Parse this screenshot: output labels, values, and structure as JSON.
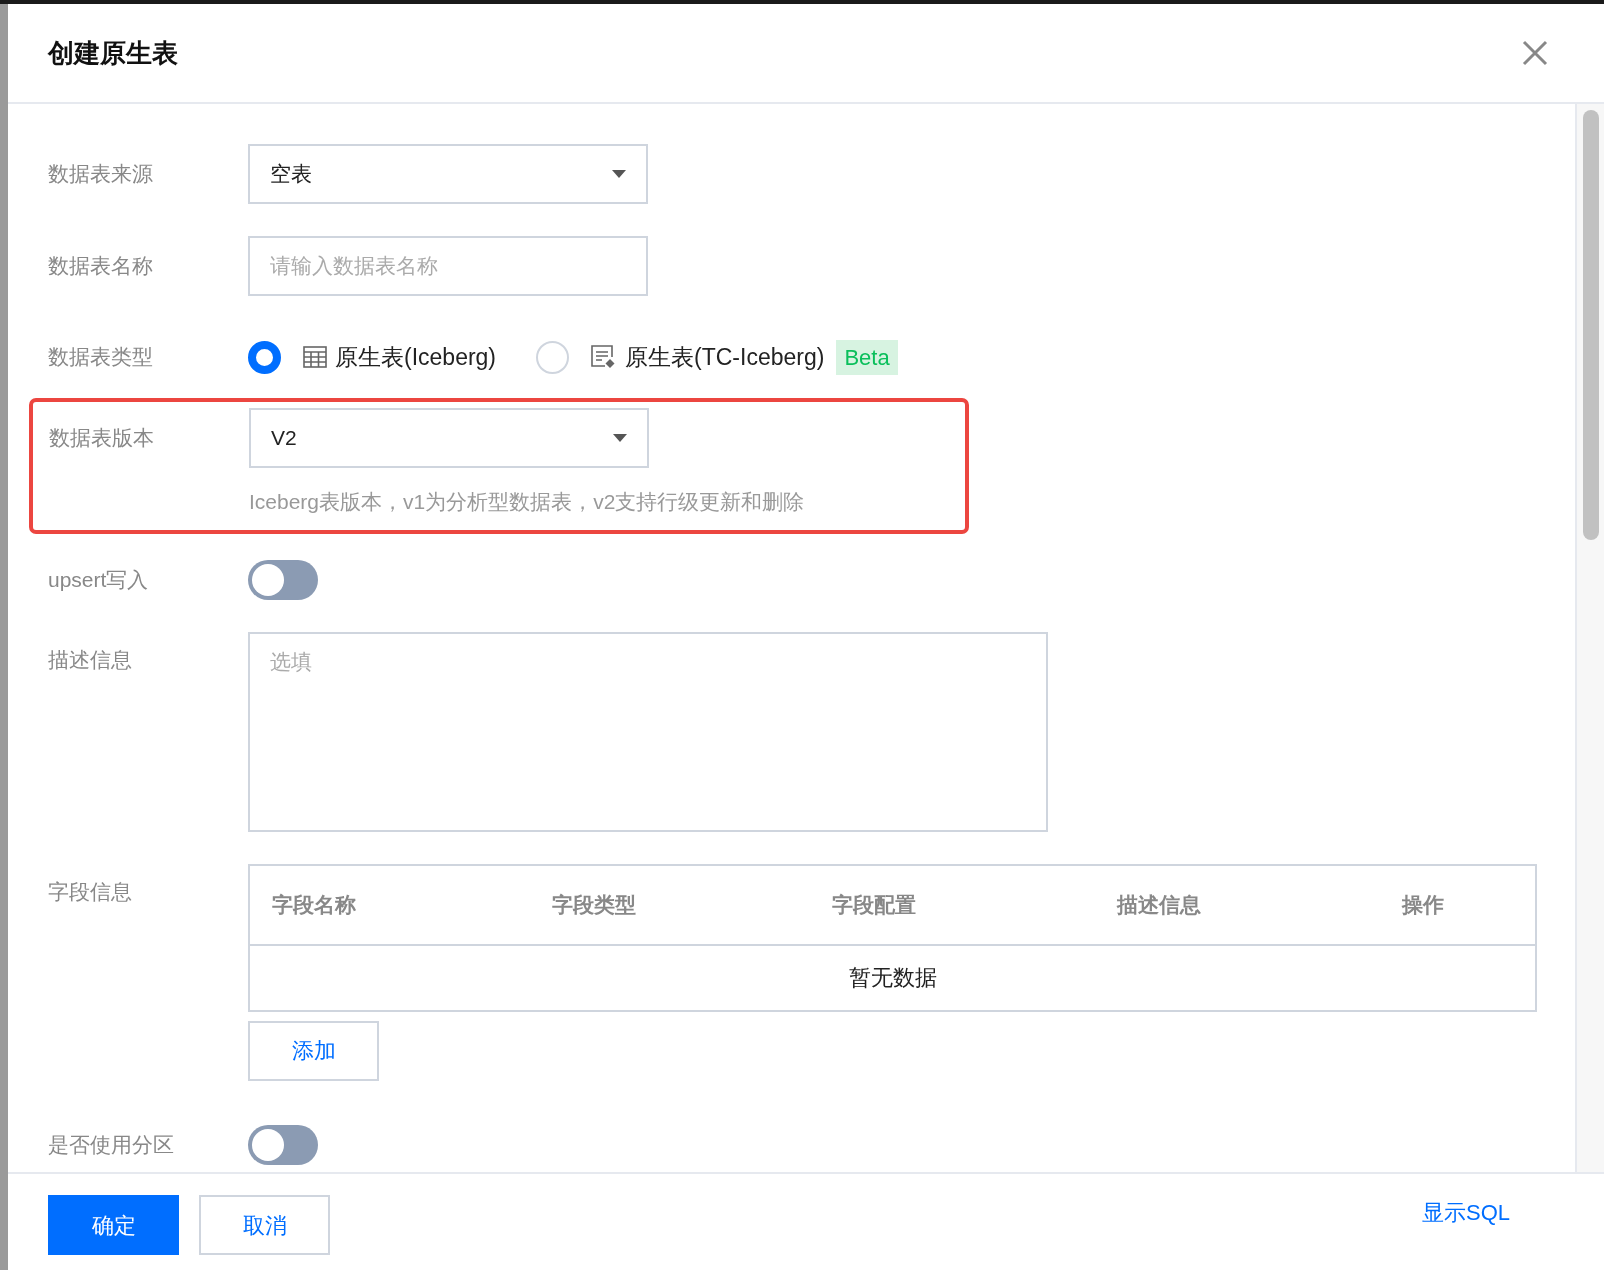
{
  "dialog": {
    "title": "创建原生表"
  },
  "fields": [
    {
      "kind": "select",
      "label": "数据表来源",
      "value": "空表"
    },
    {
      "kind": "input",
      "label": "数据表名称",
      "placeholder": "请输入数据表名称"
    },
    {
      "kind": "radio",
      "label": "数据表类型",
      "options": [
        {
          "label": "原生表(Iceberg)",
          "selected": true
        },
        {
          "label": "原生表(TC-Iceberg)",
          "selected": false,
          "badge": "Beta"
        }
      ]
    },
    {
      "kind": "select",
      "label": "数据表版本",
      "value": "V2",
      "hint": "Iceberg表版本，v1为分析型数据表，v2支持行级更新和删除",
      "highlighted": true
    },
    {
      "kind": "toggle",
      "label": "upsert写入",
      "on": false
    },
    {
      "kind": "textarea",
      "label": "描述信息",
      "placeholder": "选填"
    },
    {
      "kind": "table",
      "label": "字段信息",
      "columns": [
        "字段名称",
        "字段类型",
        "字段配置",
        "描述信息",
        "操作"
      ],
      "empty_text": "暂无数据",
      "add_button": "添加"
    },
    {
      "kind": "toggle",
      "label": "是否使用分区",
      "on": false
    }
  ],
  "footer": {
    "buttons": [
      {
        "label": "确定",
        "kind": "primary"
      },
      {
        "label": "取消",
        "kind": "secondary"
      }
    ],
    "link": "显示SQL"
  }
}
